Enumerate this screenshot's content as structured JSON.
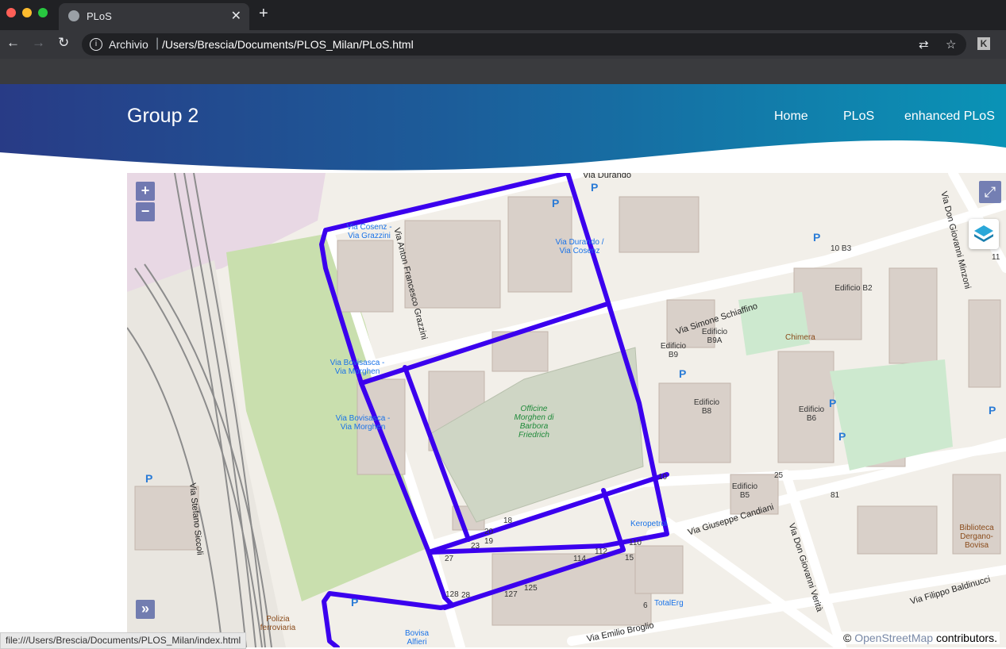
{
  "browser": {
    "tab_title": "PLoS",
    "url_scheme_label": "Archivio",
    "url_path": "/Users/Brescia/Documents/PLOS_Milan/PLoS.html",
    "extension_label": "K",
    "status_url": "file:///Users/Brescia/Documents/PLOS_Milan/index.html"
  },
  "header": {
    "brand": "Group 2",
    "nav": [
      {
        "label": "Home"
      },
      {
        "label": "PLoS"
      },
      {
        "label": "enhanced PLoS"
      }
    ]
  },
  "map": {
    "zoom_in": "+",
    "zoom_out": "−",
    "expand_toggle": "»",
    "attribution_prefix": "© ",
    "attribution_osm": "OpenStreetMap",
    "attribution_suffix": " contributors.",
    "route_color": "#3b00ee",
    "streets": [
      "Via Durando",
      "Via Simone Schiaffino",
      "Via Don Giovanni Minzoni",
      "Via Anton Francesco Grazzini",
      "Via Stefano Siccoli",
      "Via Giuseppe Candiani",
      "Via Don Giovanni Verità",
      "Via Filippo Baldinucci",
      "Via Emilio Broglio"
    ],
    "bus_stops": [
      "Via Cosenz - Via Grazzini",
      "Via Durando / Via Cosenz",
      "Via Bovisasca - Via Morghen",
      "Via Bovisasca - Via Morghen",
      "Bovisa Alfieri"
    ],
    "buildings": [
      "Edificio B2",
      "Edificio B9A",
      "Edificio B9",
      "Edificio B8",
      "Edificio B6",
      "Edificio B5",
      "10 B3"
    ],
    "pois": [
      "Officine Morghen di Barbora Friedrich",
      "Chimera",
      "Keropetrol",
      "TotalErg",
      "Biblioteca Dergano-Bovisa",
      "Polizia ferroviaria"
    ],
    "house_numbers": [
      "18",
      "20",
      "23",
      "19",
      "27",
      "28",
      "127",
      "128",
      "125",
      "114",
      "112",
      "110",
      "15",
      "10",
      "81",
      "25",
      "6",
      "11"
    ]
  }
}
